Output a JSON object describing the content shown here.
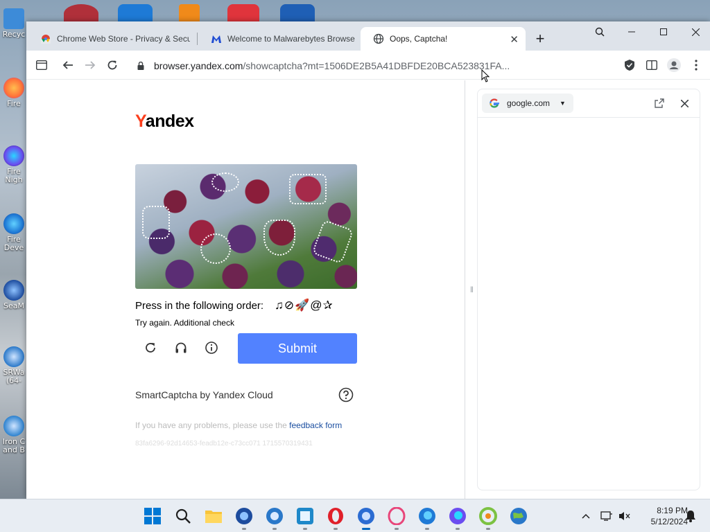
{
  "desktop": {
    "icons": [
      {
        "name": "recycle-bin",
        "label": "Recyc",
        "color": "#3d8bd8"
      },
      {
        "name": "firefox",
        "label": "Fire",
        "color": "#ff7139"
      },
      {
        "name": "firefox-nightly",
        "label": "Fire\nNigh",
        "color": "#6b4df0"
      },
      {
        "name": "firefox-developer",
        "label": "Fire\nDeve",
        "color": "#1f7ad6"
      },
      {
        "name": "seamonkey",
        "label": "SeaM",
        "color": "#1d4c9e"
      },
      {
        "name": "srware-iron-64",
        "label": "SRWa\n(64-",
        "color": "#2a78c9"
      },
      {
        "name": "iron-chrome",
        "label": "Iron C\nand B",
        "color": "#2d82cf"
      }
    ]
  },
  "browser": {
    "tabs": [
      {
        "label": "Chrome Web Store - Privacy & Secur",
        "active": false
      },
      {
        "label": "Welcome to Malwarebytes Browser",
        "active": false
      },
      {
        "label": "Oops, Captcha!",
        "active": true
      }
    ],
    "url_host": "browser.yandex.com",
    "url_path": "/showcaptcha?mt=1506DE2B5A41DBFDE20BCA523831FA..."
  },
  "page": {
    "logo_y": "Y",
    "logo_rest": "andex",
    "instruction": "Press in the following order:",
    "sequence": "♫⊘🚀@✰",
    "retry_text": "Try again. Additional check",
    "submit_label": "Submit",
    "smartcaptcha": "SmartCaptcha by Yandex Cloud",
    "problems_text": "If you have any problems, please use the",
    "feedback_link": "feedback form",
    "captcha_id": "83fa6296-92d14653-feadb12e-c73cc071 1715570319431",
    "submit_color": "#5282ff",
    "logo_color": "#fc3f1d"
  },
  "side_panel": {
    "search_label": "google.com"
  },
  "taskbar": {
    "time": "8:19 PM",
    "date": "5/12/2024"
  }
}
